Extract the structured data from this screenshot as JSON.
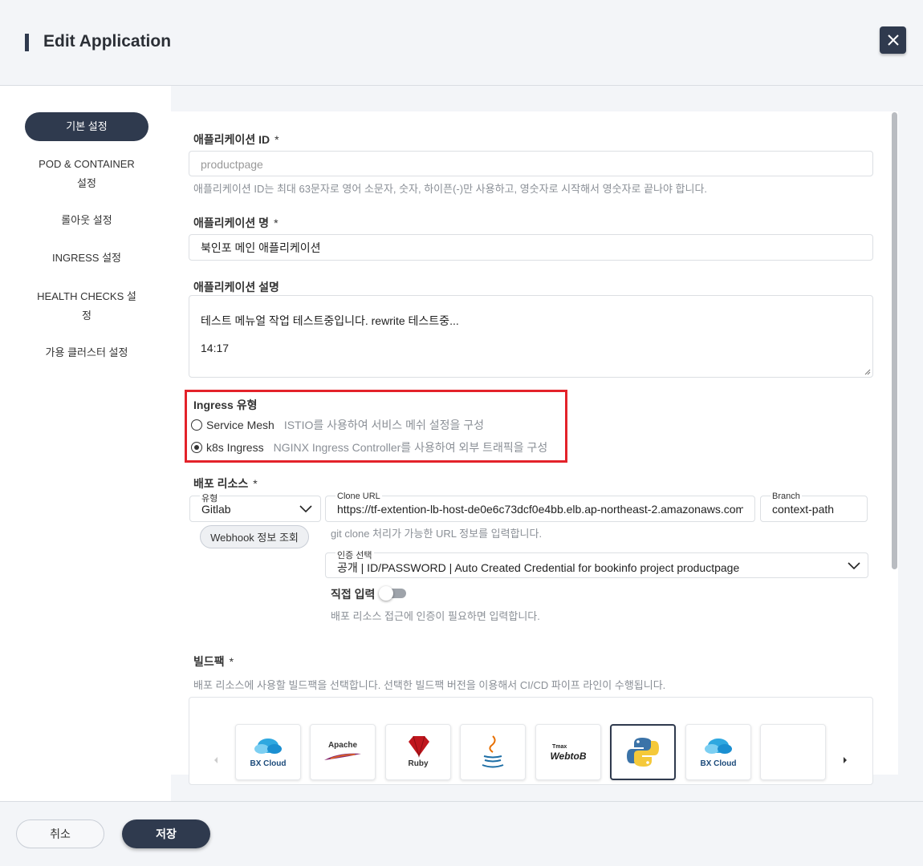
{
  "header": {
    "title": "Edit Application"
  },
  "sidebar": {
    "items": [
      {
        "label": "기본 설정"
      },
      {
        "label": "POD & CONTAINER 설정"
      },
      {
        "label": "롤아웃 설정"
      },
      {
        "label": "INGRESS 설정"
      },
      {
        "label": "HEALTH CHECKS 설정"
      },
      {
        "label": "가용 클러스터 설정"
      }
    ]
  },
  "form": {
    "app_id": {
      "label": "애플리케이션 ID",
      "required_mark": "*",
      "placeholder": "productpage",
      "help": "애플리케이션 ID는 최대 63문자로 영어 소문자, 숫자, 하이픈(-)만 사용하고, 영숫자로 시작해서 영숫자로 끝나야 합니다."
    },
    "app_name": {
      "label": "애플리케이션 명",
      "required_mark": "*",
      "value": "북인포 메인 애플리케이션"
    },
    "app_desc": {
      "label": "애플리케이션 설명",
      "line1": "테스트 메뉴얼 작업 테스트중입니다. rewrite 테스트중...",
      "line2": "14:17"
    },
    "ingress_type": {
      "label": "Ingress 유형",
      "options": [
        {
          "label": "Service Mesh",
          "desc": "ISTIO를 사용하여 서비스 메쉬 설정을 구성",
          "checked": false
        },
        {
          "label": "k8s Ingress",
          "desc": "NGINX Ingress Controller를 사용하여 외부 트래픽을 구성",
          "checked": true
        }
      ]
    },
    "deploy_source": {
      "label": "배포 리소스",
      "required_mark": "*",
      "type_label": "유형",
      "type_value": "Gitlab",
      "clone_label": "Clone URL",
      "clone_value": "https://tf-extention-lb-host-de0e6c73dcf0e4bb.elb.ap-northeast-2.amazonaws.com",
      "branch_label": "Branch",
      "branch_value": "context-path",
      "clone_help": "git clone 처리가 가능한 URL 정보를 입력합니다.",
      "webhook_button": "Webhook 정보 조회",
      "auth_label": "인증 선택",
      "auth_value": "공개 | ID/PASSWORD | Auto Created Credential for bookinfo project productpage",
      "direct_input_label": "직접 입력",
      "direct_input_help": "배포 리소스 접근에 인증이 필요하면 입력합니다."
    },
    "buildpack": {
      "label": "빌드팩",
      "required_mark": "*",
      "help": "배포 리소스에 사용할 빌드팩을 선택합니다. 선택한 빌드팩 버전을 이용해서 CI/CD 파이프 라인이 수행됩니다.",
      "cards": [
        {
          "name": "BX Cloud"
        },
        {
          "name": "Apache"
        },
        {
          "name": "Ruby"
        },
        {
          "name": ""
        },
        {
          "name": "WebtoB"
        },
        {
          "name": ""
        },
        {
          "name": "BX Cloud"
        },
        {
          "name": ""
        }
      ]
    }
  },
  "footer": {
    "cancel": "취소",
    "save": "저장"
  },
  "colors": {
    "primary": "#2f3a4e",
    "highlight": "#e3222a",
    "help_text": "#8a8f96"
  }
}
